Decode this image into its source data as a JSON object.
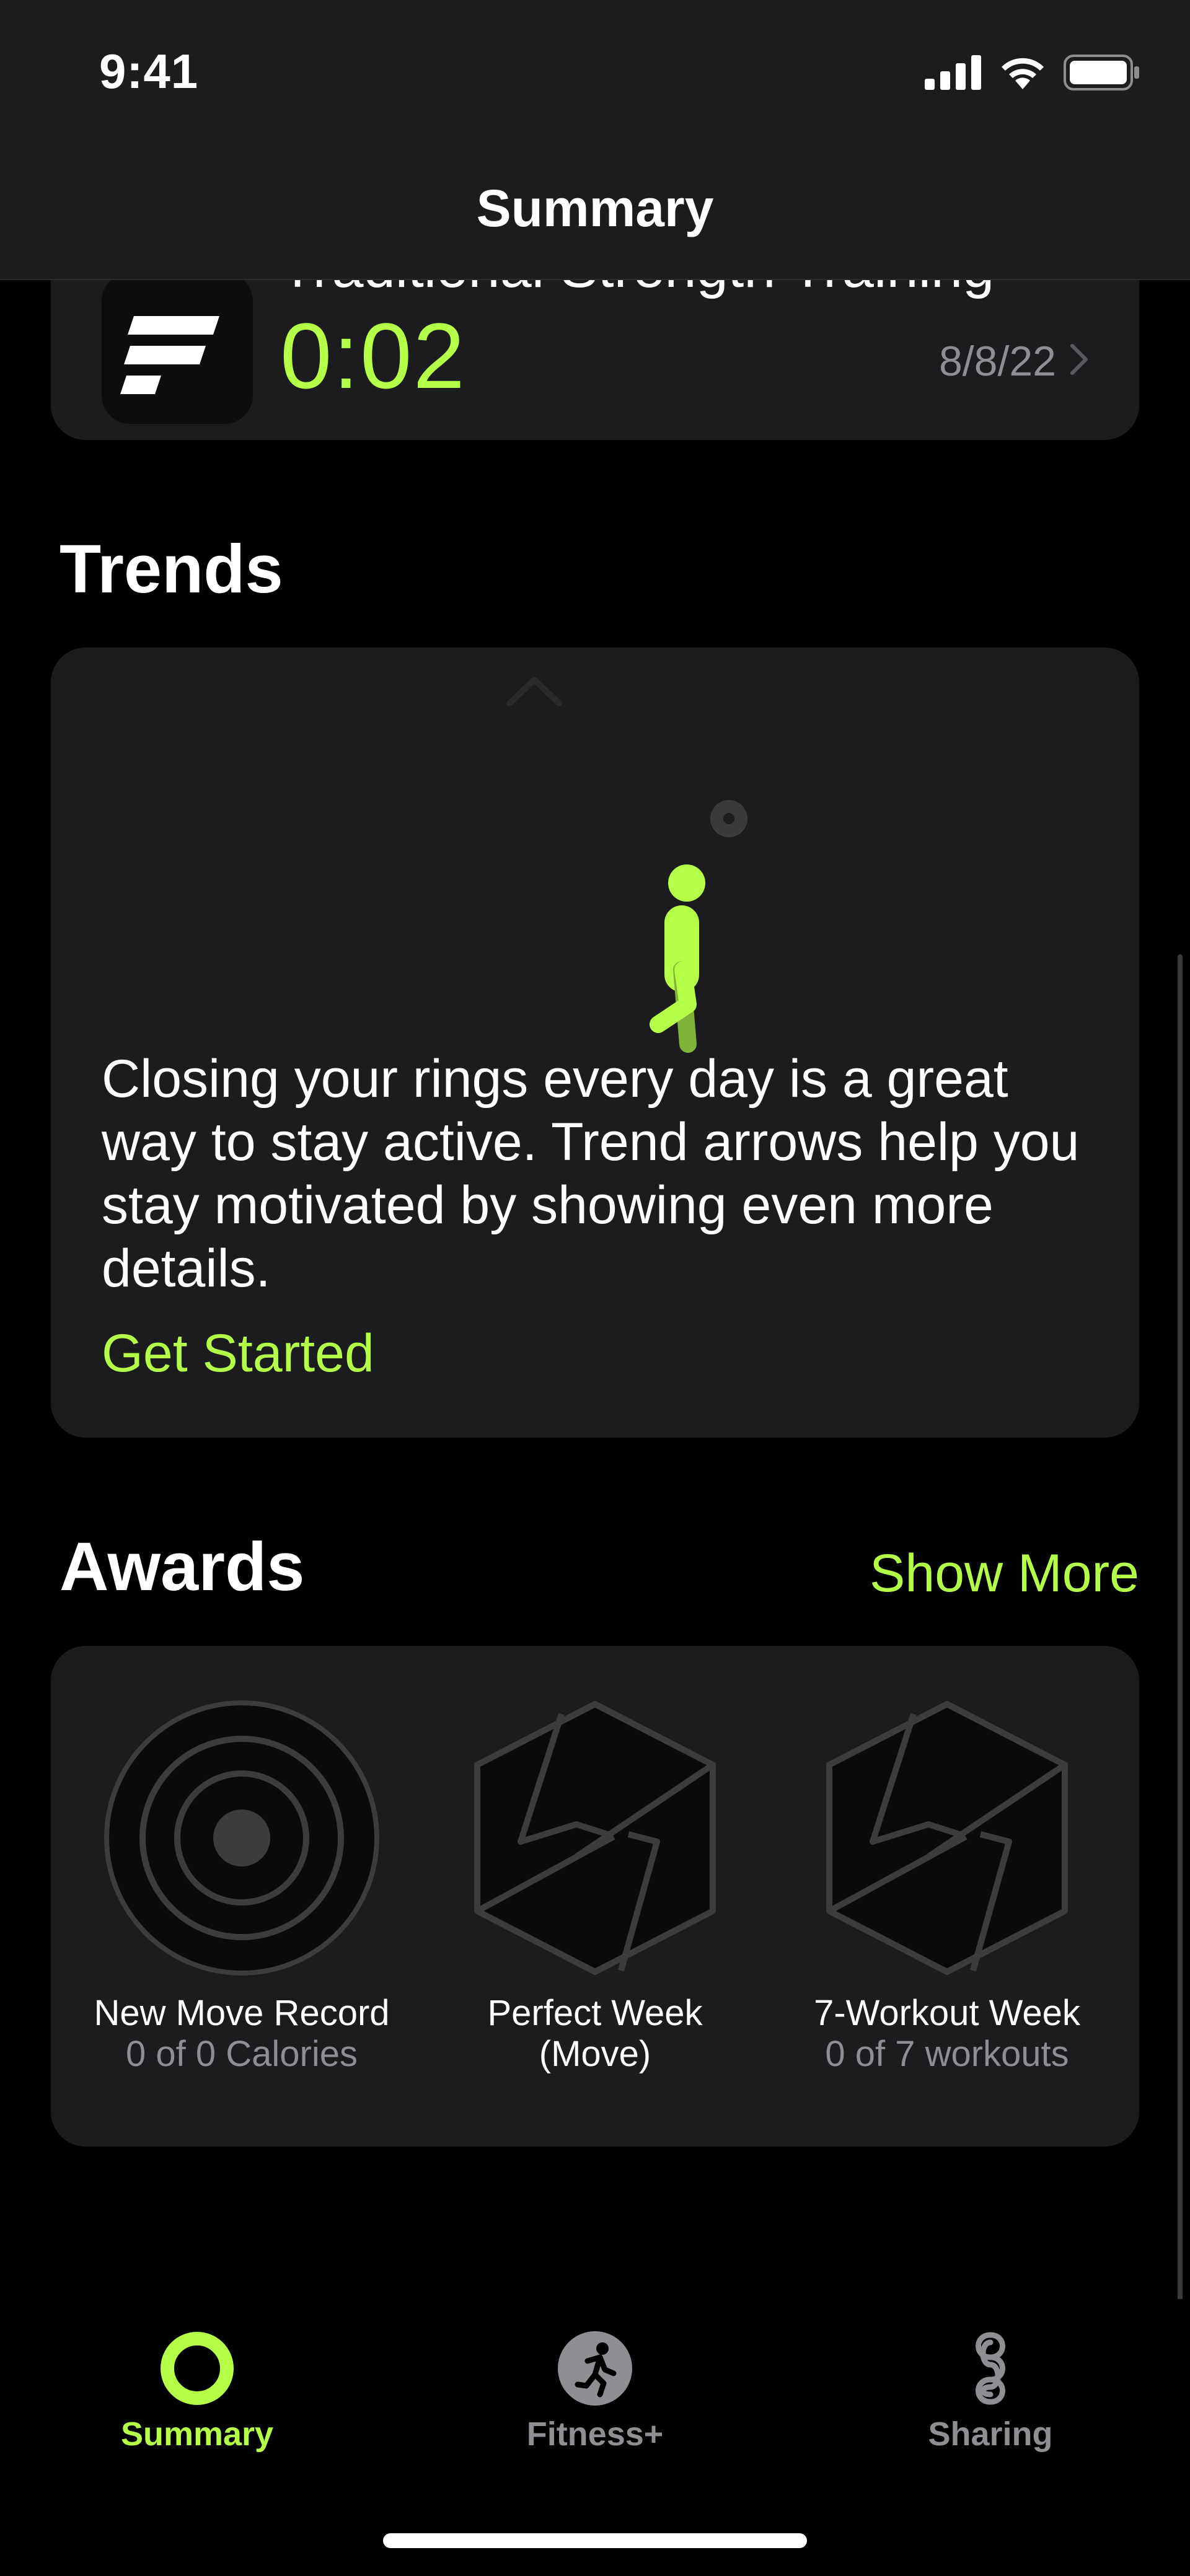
{
  "status_bar": {
    "time": "9:41"
  },
  "header": {
    "title": "Summary"
  },
  "workout": {
    "title": "Traditional Strength Training",
    "duration": "0:02",
    "date": "8/8/22"
  },
  "trends": {
    "section_title": "Trends",
    "description": "Closing your rings every day is a great way to stay active. Trend arrows help you stay motivated by showing even more details.",
    "cta": "Get Started"
  },
  "awards": {
    "section_title": "Awards",
    "show_more": "Show More",
    "items": [
      {
        "name": "New Move Record",
        "progress": "0 of 0 Calories",
        "icon": "concentric-rings-badge-icon"
      },
      {
        "name": "Perfect Week",
        "name_line2": "(Move)",
        "progress": "",
        "icon": "hexagon-bolt-badge-icon"
      },
      {
        "name": "7-Workout Week",
        "progress": "0 of 7 workouts",
        "icon": "hexagon-bolt-badge-icon"
      }
    ]
  },
  "tab_bar": {
    "items": [
      {
        "label": "Summary",
        "icon": "activity-ring-icon",
        "active": true
      },
      {
        "label": "Fitness+",
        "icon": "runner-icon",
        "active": false
      },
      {
        "label": "Sharing",
        "icon": "sharing-icon",
        "active": false
      }
    ]
  },
  "colors": {
    "accent": "#b4ff47",
    "background": "#000000",
    "card": "#1c1c1e",
    "secondary_text": "#8e8e93"
  }
}
